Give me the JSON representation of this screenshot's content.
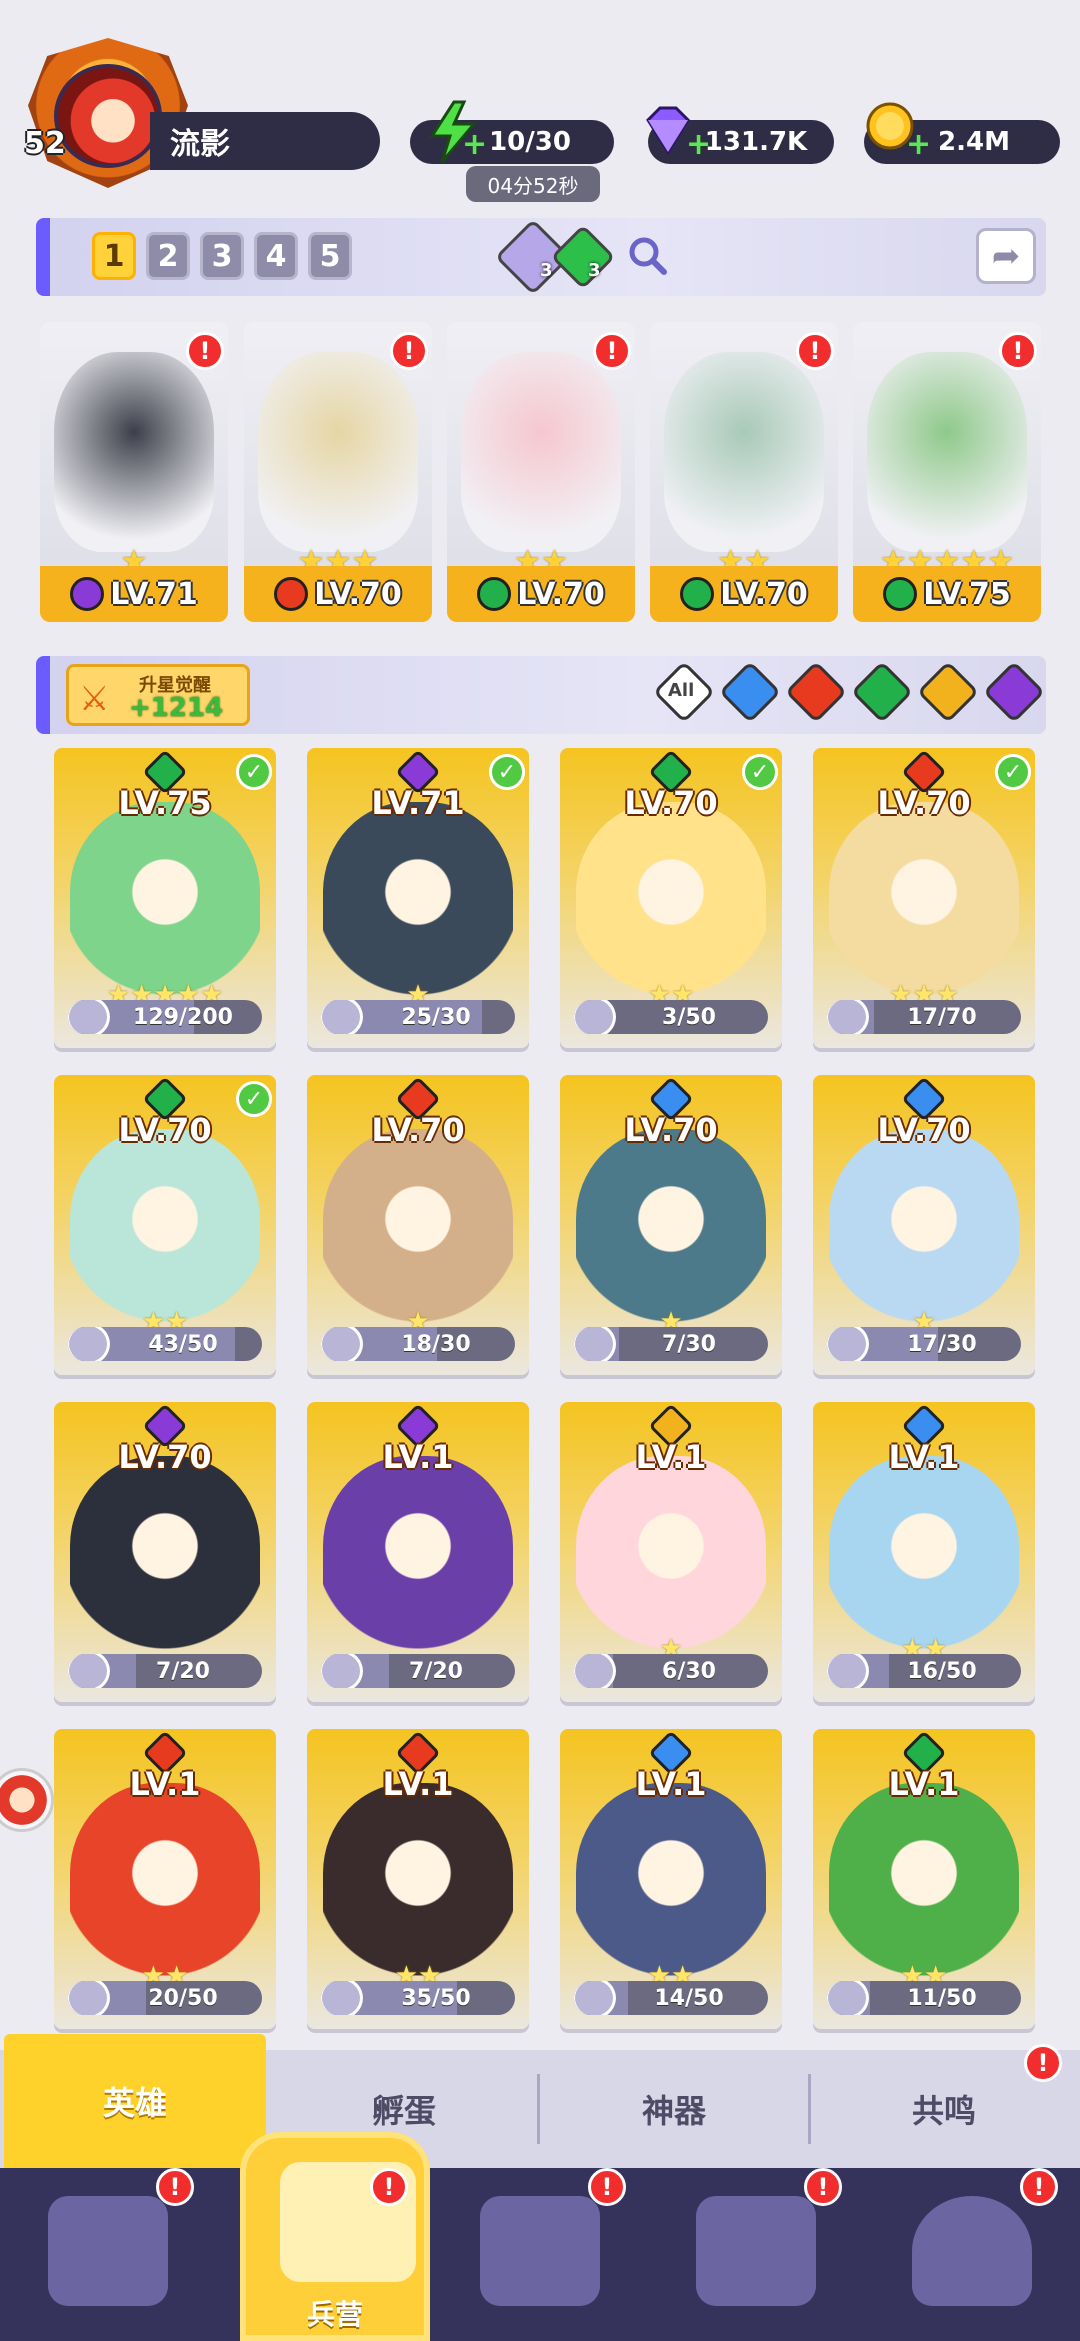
{
  "player": {
    "level": "52",
    "name": "流影"
  },
  "resources": {
    "energy": "10/30",
    "energy_timer": "04分52秒",
    "gems": "131.7K",
    "gold": "2.4M"
  },
  "team_bar": {
    "slots": [
      "1",
      "2",
      "3",
      "4",
      "5"
    ],
    "active_slot": "1",
    "purple_gem_count": "3",
    "green_gem_count": "3"
  },
  "team": [
    {
      "level": "LV.71",
      "element": "dark",
      "stars": "★",
      "alert": "!"
    },
    {
      "level": "LV.70",
      "element": "fire",
      "stars": "★★★",
      "alert": "!"
    },
    {
      "level": "LV.70",
      "element": "nature",
      "stars": "★★",
      "alert": "!"
    },
    {
      "level": "LV.70",
      "element": "nature",
      "stars": "★★",
      "alert": "!"
    },
    {
      "level": "LV.75",
      "element": "nature",
      "stars": "★★★★★",
      "alert": "!"
    }
  ],
  "filter": {
    "upgrade_label": "升星觉醒",
    "upgrade_value": "+1214",
    "all_label": "All",
    "elements": [
      "water",
      "fire",
      "nature",
      "light",
      "dark"
    ]
  },
  "heroes": [
    {
      "level": "LV.75",
      "element": "nature",
      "checked": true,
      "progress": "129/200",
      "stars": "★★★★★"
    },
    {
      "level": "LV.71",
      "element": "dark",
      "checked": true,
      "progress": "25/30",
      "stars": "★"
    },
    {
      "level": "LV.70",
      "element": "nature",
      "checked": true,
      "progress": "3/50",
      "stars": "★★"
    },
    {
      "level": "LV.70",
      "element": "fire",
      "checked": true,
      "progress": "17/70",
      "stars": "★★★"
    },
    {
      "level": "LV.70",
      "element": "nature",
      "checked": true,
      "progress": "43/50",
      "stars": "★★"
    },
    {
      "level": "LV.70",
      "element": "fire",
      "checked": false,
      "progress": "18/30",
      "stars": "★"
    },
    {
      "level": "LV.70",
      "element": "water",
      "checked": false,
      "progress": "7/30",
      "stars": "★"
    },
    {
      "level": "LV.70",
      "element": "water",
      "checked": false,
      "progress": "17/30",
      "stars": "★"
    },
    {
      "level": "LV.70",
      "element": "dark",
      "checked": false,
      "progress": "7/20",
      "stars": ""
    },
    {
      "level": "LV.1",
      "element": "dark",
      "checked": false,
      "progress": "7/20",
      "stars": ""
    },
    {
      "level": "LV.1",
      "element": "light",
      "checked": false,
      "progress": "6/30",
      "stars": "★"
    },
    {
      "level": "LV.1",
      "element": "water",
      "checked": false,
      "progress": "16/50",
      "stars": "★★"
    },
    {
      "level": "LV.1",
      "element": "fire",
      "checked": false,
      "progress": "20/50",
      "stars": "★★"
    },
    {
      "level": "LV.1",
      "element": "fire",
      "checked": false,
      "progress": "35/50",
      "stars": "★★"
    },
    {
      "level": "LV.1",
      "element": "water",
      "checked": false,
      "progress": "14/50",
      "stars": "★★"
    },
    {
      "level": "LV.1",
      "element": "nature",
      "checked": false,
      "progress": "11/50",
      "stars": "★★"
    }
  ],
  "sub_tabs": [
    {
      "label": "英雄"
    },
    {
      "label": "孵蛋"
    },
    {
      "label": "神器"
    },
    {
      "label": "共鸣"
    }
  ],
  "bottom_nav": [
    {
      "label": "",
      "icon": "cards-icon"
    },
    {
      "label": "兵营",
      "icon": "barracks-icon"
    },
    {
      "label": "",
      "icon": "book-icon"
    },
    {
      "label": "",
      "icon": "shop-icon"
    },
    {
      "label": "",
      "icon": "mushroom-icon"
    }
  ],
  "colors": {
    "water": "#3a8ef0",
    "fire": "#e83a1e",
    "nature": "#22b04a",
    "light": "#f2b21e",
    "dark": "#8a3ad6",
    "accent": "#ffd12b",
    "panel": "#35325b"
  }
}
